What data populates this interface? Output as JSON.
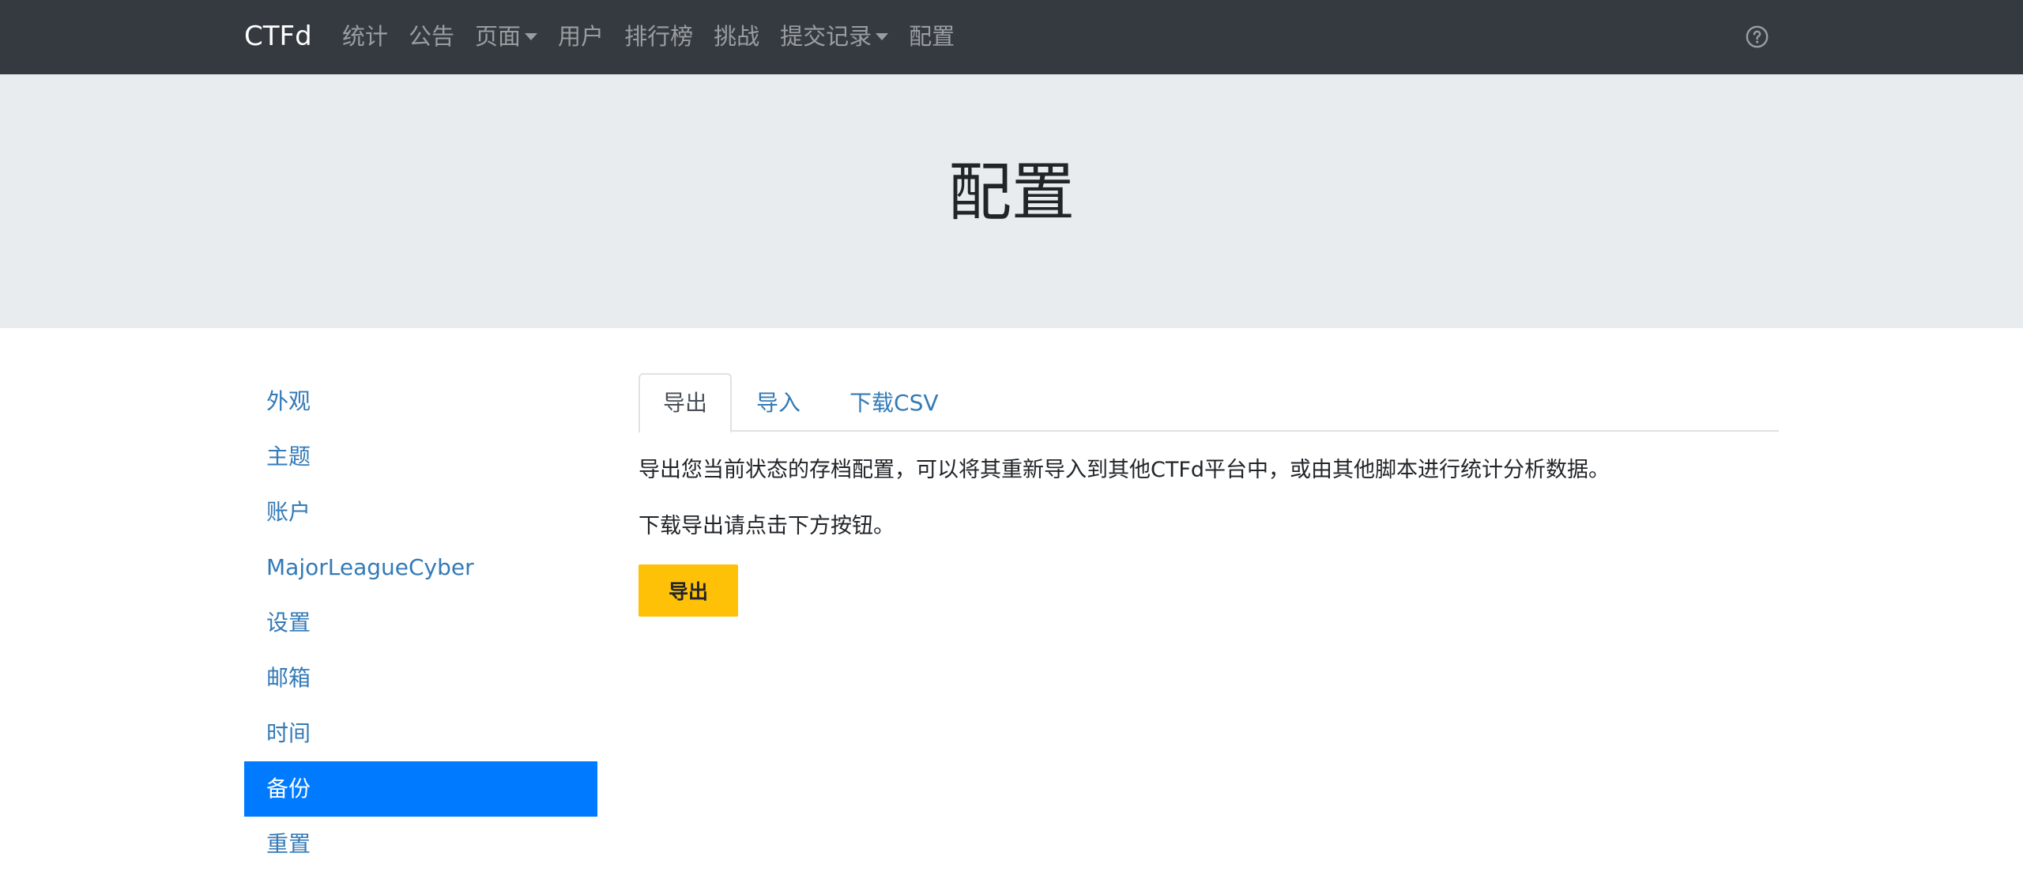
{
  "navbar": {
    "brand": "CTFd",
    "items": [
      {
        "label": "统计",
        "dropdown": false
      },
      {
        "label": "公告",
        "dropdown": false
      },
      {
        "label": "页面",
        "dropdown": true
      },
      {
        "label": "用户",
        "dropdown": false
      },
      {
        "label": "排行榜",
        "dropdown": false
      },
      {
        "label": "挑战",
        "dropdown": false
      },
      {
        "label": "提交记录",
        "dropdown": true
      },
      {
        "label": "配置",
        "dropdown": false
      }
    ],
    "help_icon": "question-circle-icon"
  },
  "page": {
    "title": "配置"
  },
  "sidebar": {
    "items": [
      {
        "label": "外观",
        "active": false
      },
      {
        "label": "主题",
        "active": false
      },
      {
        "label": "账户",
        "active": false
      },
      {
        "label": "MajorLeagueCyber",
        "active": false
      },
      {
        "label": "设置",
        "active": false
      },
      {
        "label": "邮箱",
        "active": false
      },
      {
        "label": "时间",
        "active": false
      },
      {
        "label": "备份",
        "active": true
      },
      {
        "label": "重置",
        "active": false
      }
    ]
  },
  "tabs": [
    {
      "label": "导出",
      "active": true
    },
    {
      "label": "导入",
      "active": false
    },
    {
      "label": "下载CSV",
      "active": false
    }
  ],
  "export_panel": {
    "description": "导出您当前状态的存档配置，可以将其重新导入到其他CTFd平台中，或由其他脚本进行统计分析数据。",
    "instruction": "下载导出请点击下方按钮。",
    "button_label": "导出"
  },
  "colors": {
    "navbar_bg": "#343a40",
    "jumbotron_bg": "#e9ecef",
    "link": "#337ab7",
    "active_sidebar": "#007bff",
    "export_button": "#ffc107"
  }
}
